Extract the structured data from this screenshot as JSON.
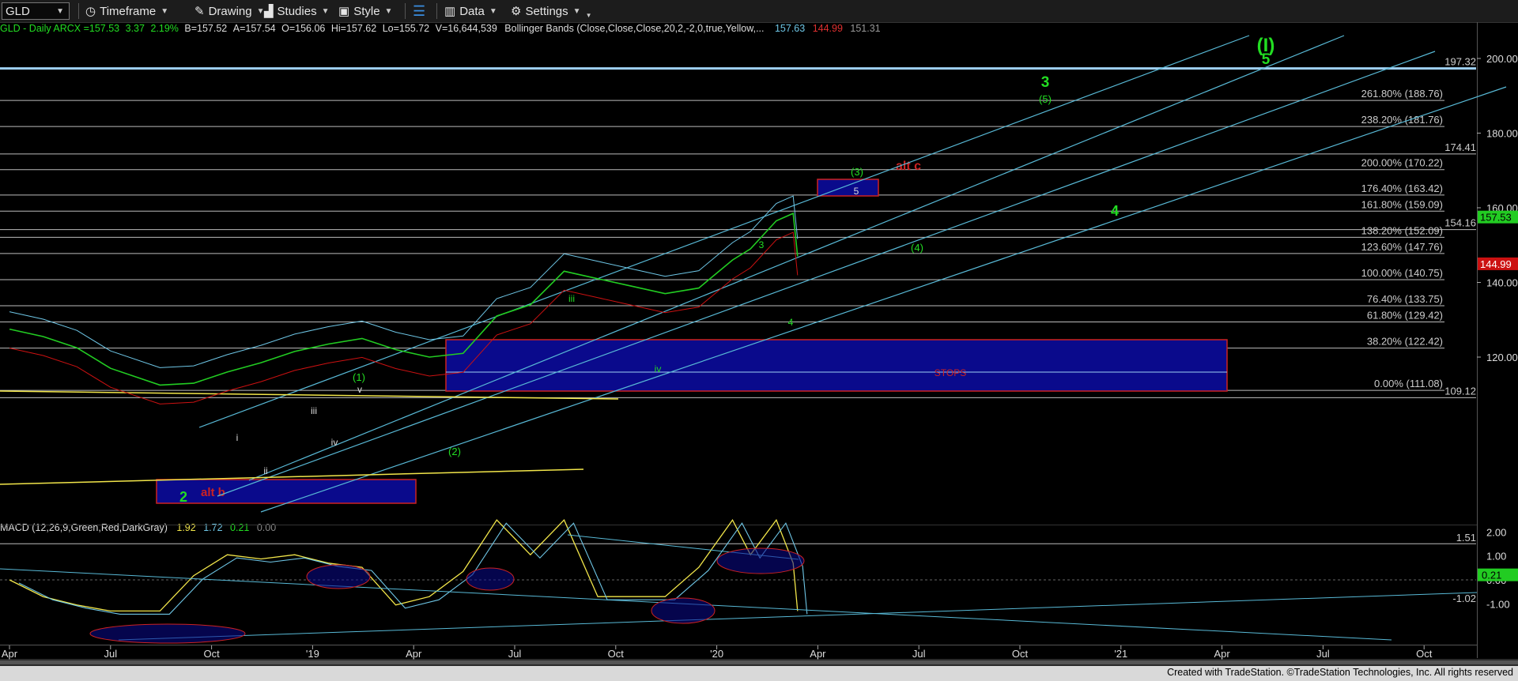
{
  "toolbar": {
    "symbol": "GLD",
    "timeframe": "Timeframe",
    "drawing": "Drawing",
    "studies": "Studies",
    "style": "Style",
    "data": "Data",
    "settings": "Settings"
  },
  "infobar": {
    "symbol_desc": "GLD - Daily  ARCX",
    "last": "=157.53",
    "change": "3.37",
    "pct": "2.19%",
    "bid": "B=157.52",
    "ask": "A=157.54",
    "open": "O=156.06",
    "high": "Hi=157.62",
    "low": "Lo=155.72",
    "volume": "V=16,644,539",
    "study": "Bollinger Bands (Close,Close,Close,20,2,-2,0,true,Yellow,...",
    "bb_upper": "157.63",
    "bb_lower": "144.99",
    "bb_mid": "151.31"
  },
  "macd_legend": {
    "label": "MACD (12,26,9,Green,Red,DarkGray)",
    "macd": "1.92",
    "signal": "1.72",
    "hist": "0.21",
    "zero": "0.00"
  },
  "footer": {
    "text": "Created with TradeStation. ©TradeStation Technologies, Inc. All rights reserved"
  },
  "chart_data": {
    "type": "line",
    "title": "",
    "price_axis": {
      "ticks": [
        120,
        140,
        160,
        180,
        200
      ],
      "ylim": [
        103,
        208
      ]
    },
    "macd_axis": {
      "ticks": [
        -1.0,
        0.0,
        1.0,
        2.0
      ],
      "ylim": [
        -1.5,
        2.8
      ]
    },
    "time_axis": {
      "labels": [
        "Apr",
        "Jul",
        "Oct",
        "'19",
        "Apr",
        "Jul",
        "Oct",
        "'20",
        "Apr",
        "Jul",
        "Oct",
        "'21",
        "Apr",
        "Jul",
        "Oct"
      ],
      "range": [
        "2018-04",
        "2021-11"
      ]
    },
    "series": [
      {
        "name": "GLD",
        "x": [
          "2018-04-01",
          "2018-05-01",
          "2018-06-01",
          "2018-07-01",
          "2018-08-15",
          "2018-09-15",
          "2018-10-15",
          "2018-11-15",
          "2018-12-15",
          "2019-01-15",
          "2019-02-15",
          "2019-03-15",
          "2019-04-15",
          "2019-05-15",
          "2019-06-15",
          "2019-07-15",
          "2019-08-15",
          "2019-09-15",
          "2019-10-15",
          "2019-11-15",
          "2019-12-15",
          "2020-01-15",
          "2020-02-01",
          "2020-02-24",
          "2020-03-09",
          "2020-03-13"
        ],
        "y": [
          127.5,
          125.5,
          122.5,
          117,
          112.5,
          113,
          116,
          118.5,
          121.5,
          123.5,
          125,
          122,
          120,
          121,
          131,
          134,
          143,
          141,
          139,
          137,
          138.5,
          146,
          149,
          156.5,
          158.5,
          147
        ]
      }
    ],
    "retracement_levels": [
      {
        "label": "261.80% (188.76)",
        "value": 188.76
      },
      {
        "label": "238.20% (181.76)",
        "value": 181.76
      },
      {
        "label": "200.00% (170.22)",
        "value": 170.22
      },
      {
        "label": "176.40% (163.42)",
        "value": 163.42
      },
      {
        "label": "161.80% (159.09)",
        "value": 159.09
      },
      {
        "label": "138.20% (152.09)",
        "value": 152.09
      },
      {
        "label": "123.60% (147.76)",
        "value": 147.76
      },
      {
        "label": "100.00% (140.75)",
        "value": 140.75
      },
      {
        "label": "76.40% (133.75)",
        "value": 133.75
      },
      {
        "label": "61.80% (129.42)",
        "value": 129.42
      },
      {
        "label": "38.20% (122.42)",
        "value": 122.42
      },
      {
        "label": "0.00% (111.08)",
        "value": 111.08
      }
    ],
    "price_markers": [
      {
        "label": "197.32",
        "value": 197.32
      },
      {
        "label": "174.41",
        "value": 174.41
      },
      {
        "label": "154.16",
        "value": 154.16
      },
      {
        "label": "109.12",
        "value": 109.12
      }
    ],
    "price_tags": [
      {
        "label": "157.53",
        "value": 157.53,
        "color": "#22cc22"
      },
      {
        "label": "144.99",
        "value": 144.99,
        "color": "#cc1111"
      }
    ],
    "macd_markers": [
      {
        "label": "1.51",
        "value": 1.51
      },
      {
        "label": "-1.02",
        "value": -1.02
      }
    ],
    "macd_tag": {
      "label": "0.21",
      "value": 0.21
    },
    "box_labels": {
      "stops": "STOPS",
      "alt_b": "alt b",
      "alt_c": "alt c",
      "five": "5"
    },
    "wave_labels": [
      {
        "text": "(I)",
        "color": "#22dd22",
        "big": true
      },
      {
        "text": "5",
        "color": "#22dd22",
        "big": true
      },
      {
        "text": "3",
        "color": "#22dd22",
        "big": true
      },
      {
        "text": "(5)",
        "color": "#22dd22"
      },
      {
        "text": "(3)",
        "color": "#22dd22"
      },
      {
        "text": "4",
        "color": "#22dd22",
        "big": true
      },
      {
        "text": "(4)",
        "color": "#22dd22"
      },
      {
        "text": "3",
        "color": "#22dd22"
      },
      {
        "text": "4",
        "color": "#22dd22"
      },
      {
        "text": "iii",
        "color": "#22dd22"
      },
      {
        "text": "iv",
        "color": "#22dd22"
      },
      {
        "text": "(1)",
        "color": "#22dd22"
      },
      {
        "text": "v",
        "color": "#dddddd"
      },
      {
        "text": "iii",
        "color": "#dddddd"
      },
      {
        "text": "iv",
        "color": "#dddddd"
      },
      {
        "text": "i",
        "color": "#dddddd"
      },
      {
        "text": "ii",
        "color": "#dddddd"
      },
      {
        "text": "(2)",
        "color": "#22dd22"
      },
      {
        "text": "2",
        "color": "#22dd22",
        "big": true
      }
    ],
    "grid": false,
    "legend": "top-left"
  }
}
